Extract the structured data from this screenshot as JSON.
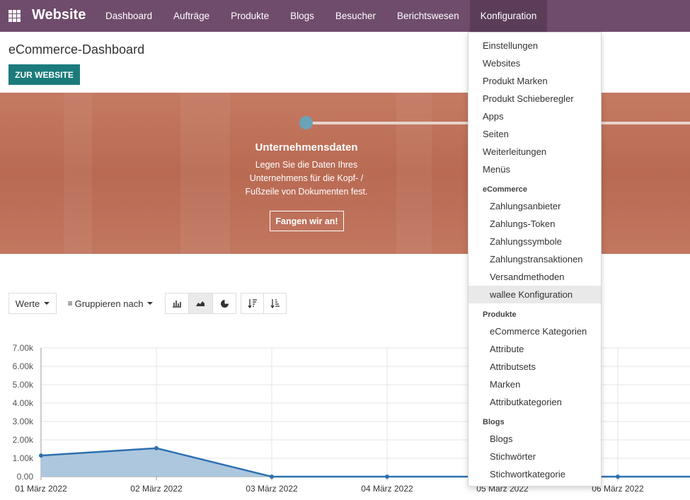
{
  "topbar": {
    "brand": "Website",
    "menu": [
      "Dashboard",
      "Aufträge",
      "Produkte",
      "Blogs",
      "Besucher",
      "Berichtswesen",
      "Konfiguration"
    ],
    "active": "Konfiguration"
  },
  "page": {
    "title": "eCommerce-Dashboard",
    "website_button": "ZUR WEBSITE"
  },
  "banner": {
    "title": "Unternehmensdaten",
    "text": "Legen Sie die Daten Ihres Unternehmens für die Kopf- / Fußzeile von Dokumenten fest.",
    "button": "Fangen wir an!"
  },
  "toolbar": {
    "measures": "Werte",
    "group_by": "Gruppieren nach",
    "icons": [
      "bar-chart-icon",
      "line-chart-icon",
      "pie-chart-icon",
      "sort-descending-icon",
      "sort-ascending-icon"
    ],
    "active_icon": "line-chart-icon"
  },
  "dropdown": {
    "items_top": [
      "Einstellungen",
      "Websites",
      "Produkt Marken",
      "Produkt Schieberegler",
      "Apps",
      "Seiten",
      "Weiterleitungen",
      "Menüs"
    ],
    "section_ecommerce": "eCommerce",
    "items_ecommerce": [
      "Zahlungsanbieter",
      "Zahlungs-Token",
      "Zahlungssymbole",
      "Zahlungstransaktionen",
      "Versandmethoden",
      "wallee Konfiguration"
    ],
    "highlighted": "wallee Konfiguration",
    "section_produkte": "Produkte",
    "items_produkte": [
      "eCommerce Kategorien",
      "Attribute",
      "Attributsets",
      "Marken",
      "Attributkategorien"
    ],
    "section_blogs": "Blogs",
    "items_blogs": [
      "Blogs",
      "Stichwörter",
      "Stichwortkategorie"
    ]
  },
  "chart_data": {
    "type": "area",
    "title": "",
    "xlabel": "",
    "ylabel": "",
    "categories": [
      "01 März 2022",
      "02 März 2022",
      "03 März 2022",
      "04 März 2022",
      "05 März 2022",
      "06 März 2022"
    ],
    "y_ticks": [
      "0.00",
      "1.00k",
      "2.00k",
      "3.00k",
      "4.00k",
      "5.00k",
      "6.00k",
      "7.00k"
    ],
    "ylim": [
      0,
      7000
    ],
    "series": [
      {
        "values": [
          1150,
          1550,
          0,
          0,
          0,
          0
        ]
      }
    ],
    "colors": {
      "line": "#2d6fae",
      "fill": "#a8c4dc"
    },
    "grid": true
  }
}
